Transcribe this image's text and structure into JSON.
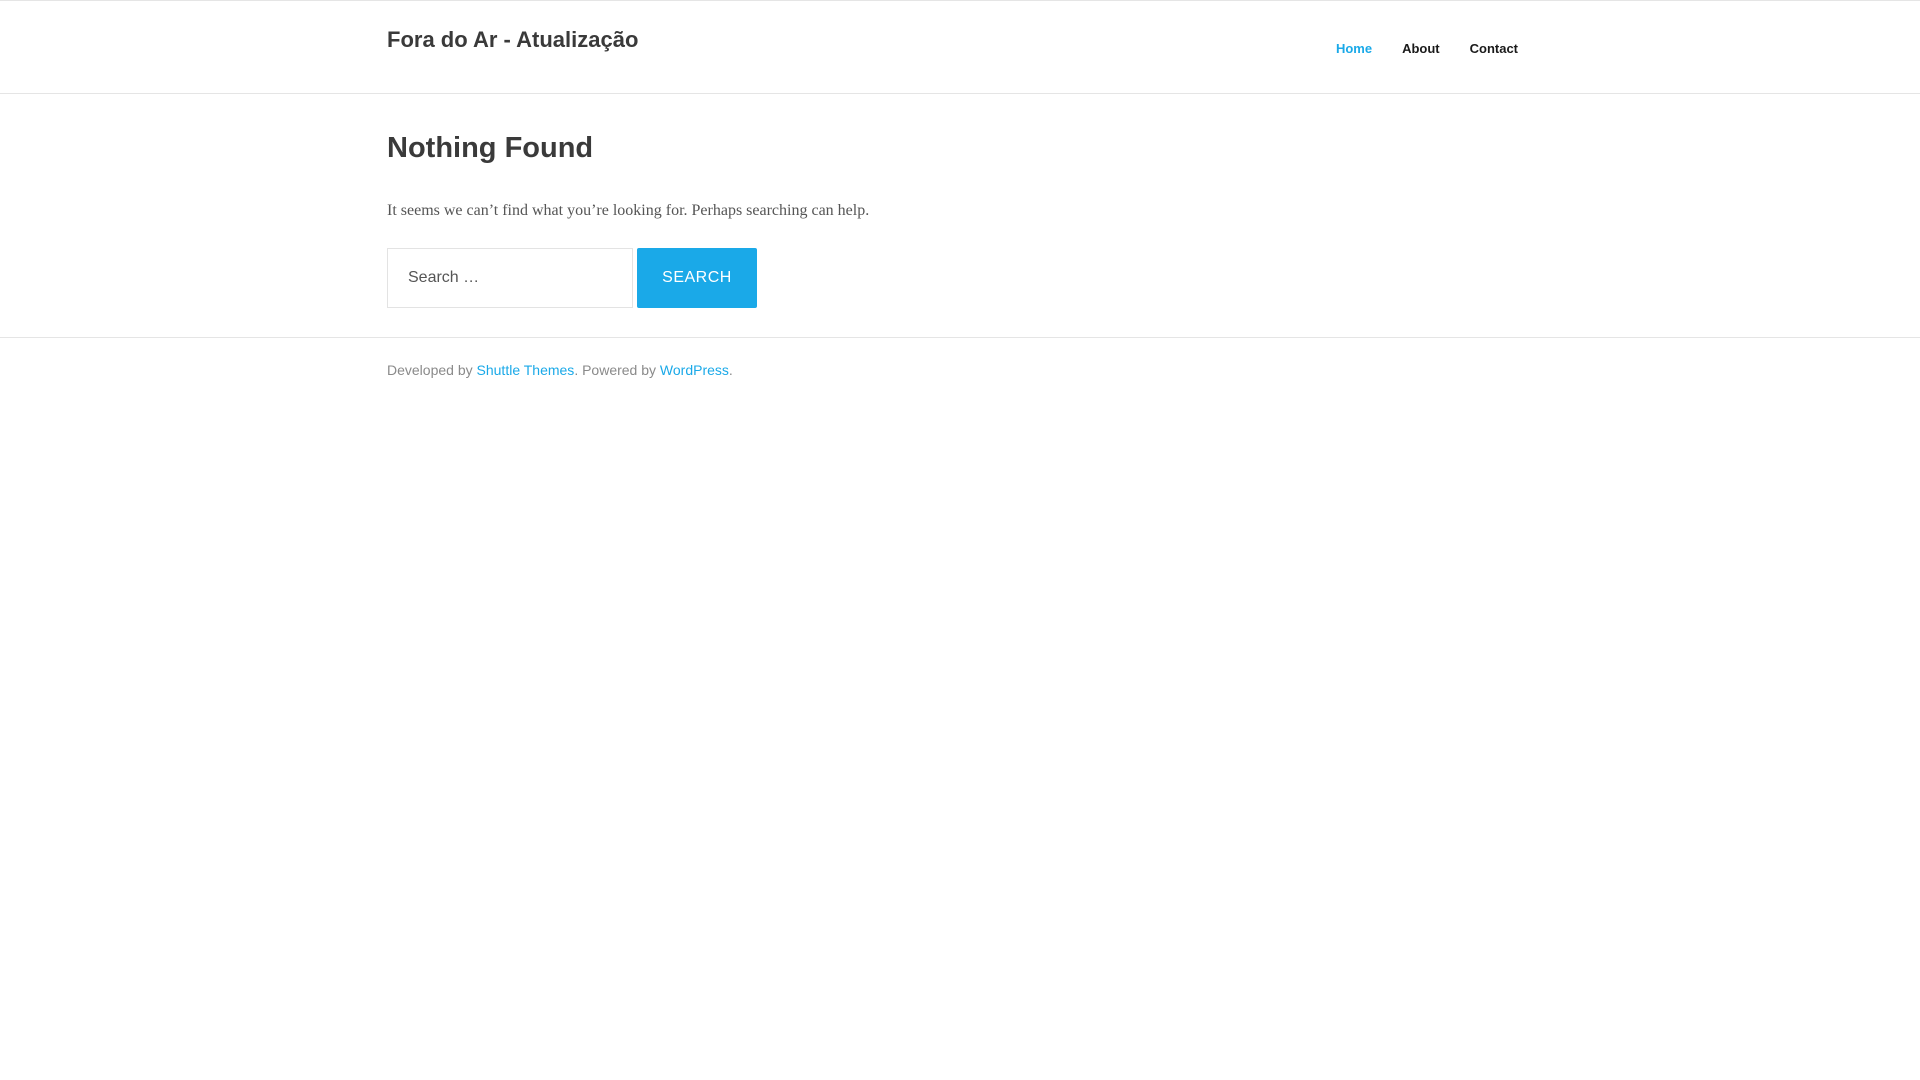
{
  "header": {
    "site_title": "Fora do Ar - Atualização",
    "nav": [
      {
        "label": "Home"
      },
      {
        "label": "About"
      },
      {
        "label": "Contact"
      }
    ]
  },
  "main": {
    "title": "Nothing Found",
    "message": "It seems we can’t find what you’re looking for. Perhaps searching can help.",
    "search": {
      "placeholder": "Search …",
      "value": "",
      "button_label": "Search"
    }
  },
  "footer": {
    "developed_prefix": "Developed by",
    "developer_link": "Shuttle Themes",
    "powered_prefix": ". Powered by",
    "powered_link": "WordPress",
    "suffix": "."
  },
  "colors": {
    "accent": "#1aa9e8",
    "title": "#3a3a3a",
    "text": "#555555",
    "muted": "#8a8a8a",
    "border": "#e5e5e5"
  }
}
